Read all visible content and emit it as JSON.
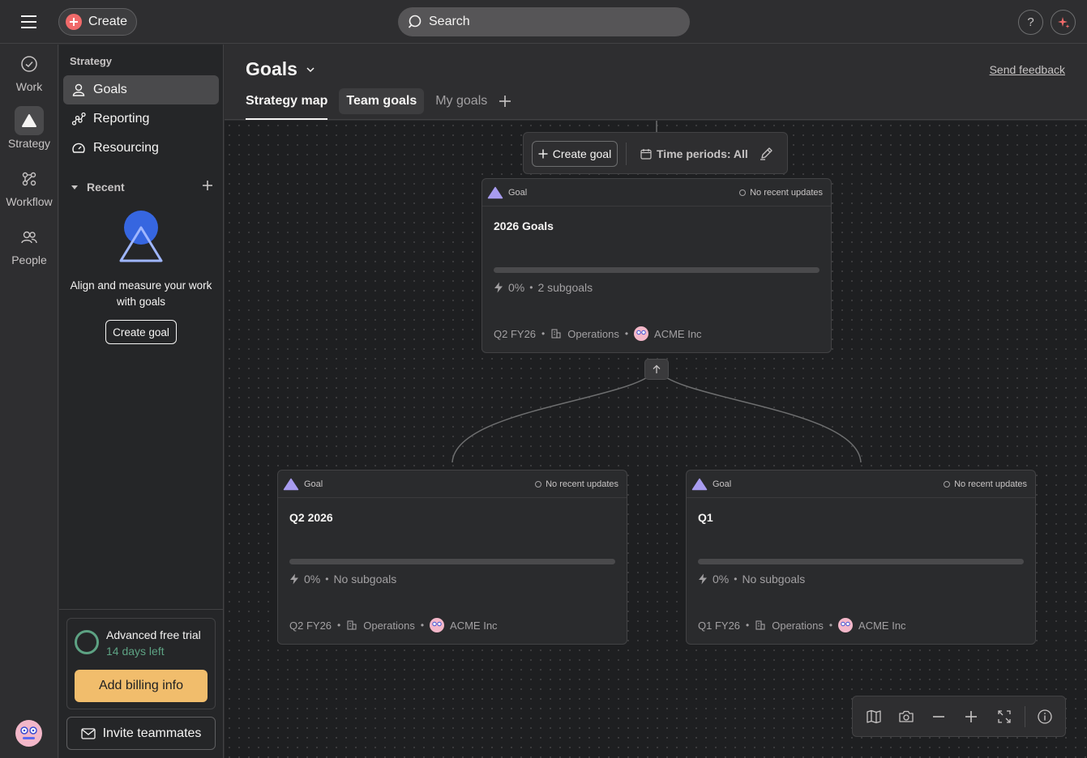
{
  "topbar": {
    "create_label": "Create",
    "search_placeholder": "Search",
    "help_label": "?"
  },
  "rail": {
    "items": [
      {
        "label": "Work",
        "icon": "check-circle-icon"
      },
      {
        "label": "Strategy",
        "icon": "triangle-icon"
      },
      {
        "label": "Workflow",
        "icon": "workflow-icon"
      },
      {
        "label": "People",
        "icon": "people-icon"
      }
    ]
  },
  "sidebar": {
    "section": "Strategy",
    "items": [
      {
        "label": "Goals",
        "icon": "person-icon"
      },
      {
        "label": "Reporting",
        "icon": "reporting-icon"
      },
      {
        "label": "Resourcing",
        "icon": "gauge-icon"
      }
    ],
    "recent_label": "Recent",
    "empty_text": "Align and measure your work with goals",
    "create_goal_label": "Create goal",
    "trial": {
      "title": "Advanced free trial",
      "days_left": "14 days left",
      "billing_label": "Add billing info"
    },
    "invite_label": "Invite teammates"
  },
  "header": {
    "title": "Goals",
    "send_feedback": "Send feedback",
    "tabs": [
      {
        "label": "Strategy map",
        "active": true
      },
      {
        "label": "Team goals",
        "active": false
      },
      {
        "label": "My goals",
        "active": false
      }
    ]
  },
  "toolbar": {
    "create_goal_label": "Create goal",
    "time_periods_label": "Time periods: All"
  },
  "goals": [
    {
      "type_label": "Goal",
      "status": "No recent updates",
      "title": "2026 Goals",
      "progress": 0,
      "progress_label": "0%",
      "subgoals": "2 subgoals",
      "period": "Q2 FY26",
      "team": "Operations",
      "owner": "ACME Inc"
    },
    {
      "type_label": "Goal",
      "status": "No recent updates",
      "title": "Q2 2026",
      "progress": 0,
      "progress_label": "0%",
      "subgoals": "No subgoals",
      "period": "Q2 FY26",
      "team": "Operations",
      "owner": "ACME Inc"
    },
    {
      "type_label": "Goal",
      "status": "No recent updates",
      "title": "Q1",
      "progress": 0,
      "progress_label": "0%",
      "subgoals": "No subgoals",
      "period": "Q1 FY26",
      "team": "Operations",
      "owner": "ACME Inc"
    }
  ],
  "colors": {
    "accent_create": "#f06a6a",
    "goal_triangle": "#a89cf0",
    "trial_green": "#5da283",
    "billing_button": "#f1bd6c",
    "canvas_bg": "#1e1f21"
  }
}
